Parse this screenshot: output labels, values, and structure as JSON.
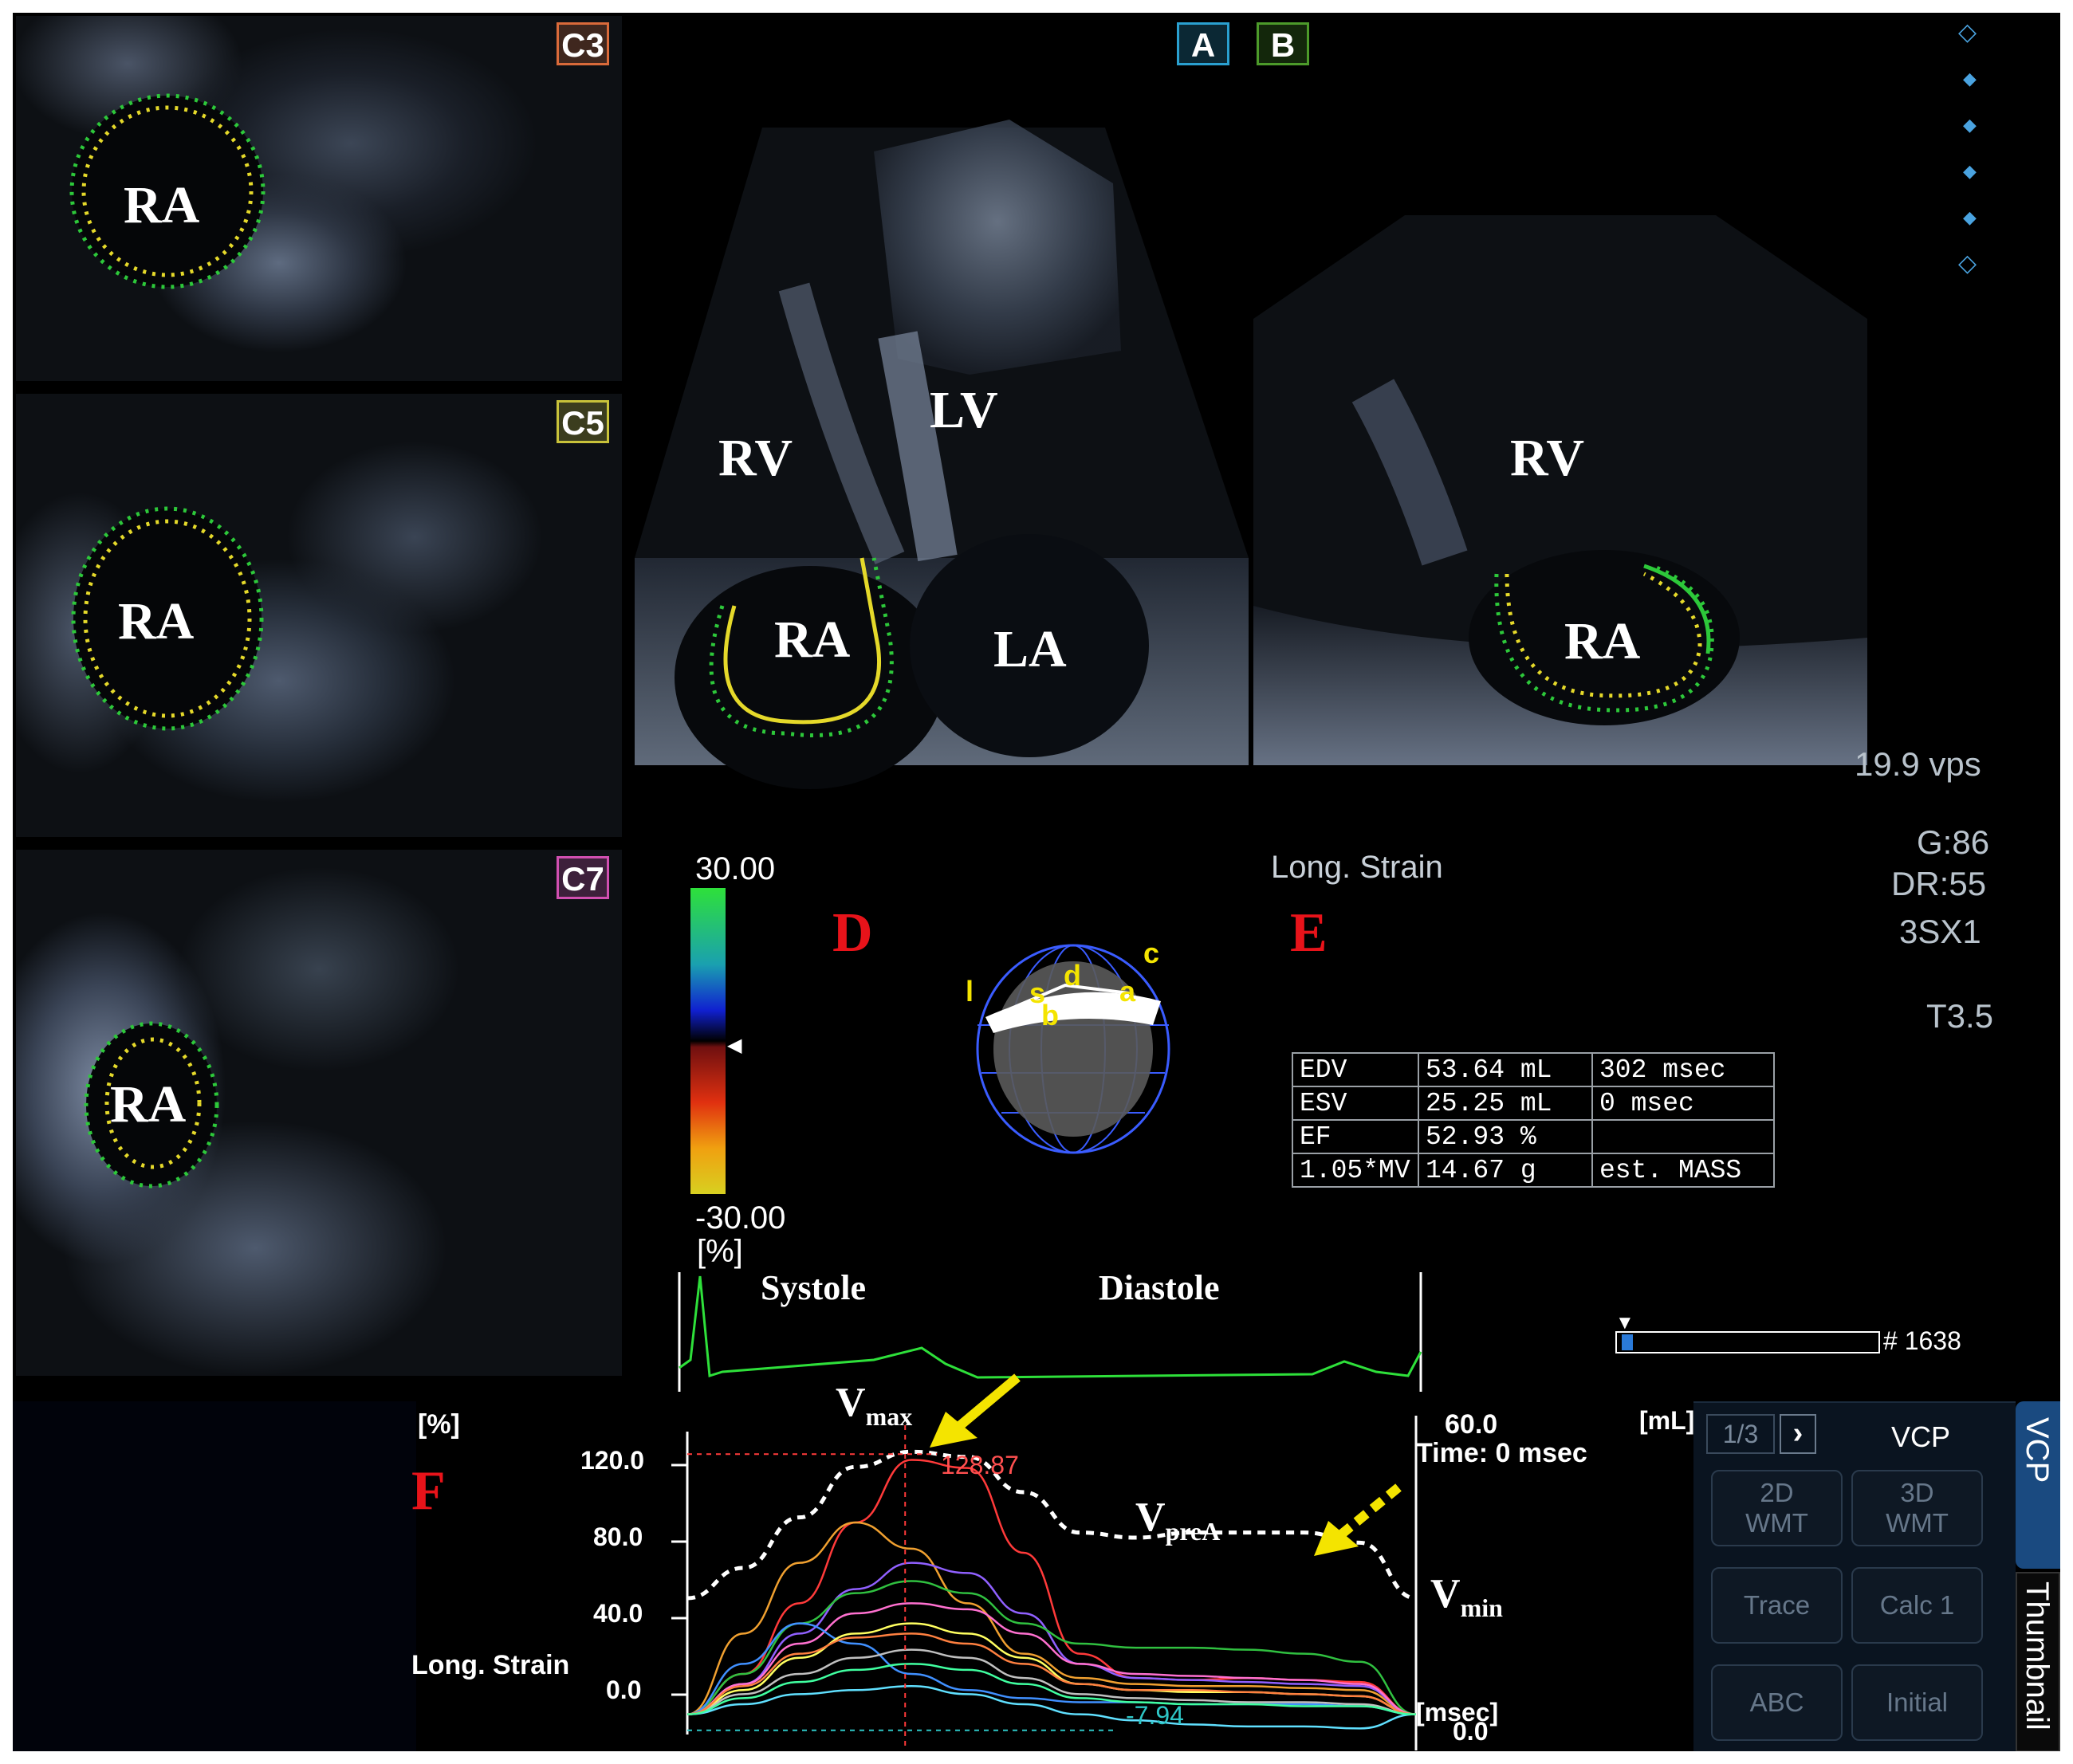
{
  "views": {
    "c3": {
      "tag": "C3",
      "label": "RA"
    },
    "c5": {
      "tag": "C5",
      "label": "RA"
    },
    "c7": {
      "tag": "C7",
      "label": "RA"
    },
    "a": {
      "tag": "A",
      "labels": {
        "rv": "RV",
        "lv": "LV",
        "ra": "RA",
        "la": "LA"
      }
    },
    "b": {
      "tag": "B",
      "labels": {
        "rv": "RV",
        "ra": "RA"
      }
    }
  },
  "tag_colors": {
    "c3": "#d96a3a",
    "c5": "#c8c23a",
    "c7": "#d04fb0",
    "a": "#2aa0d0",
    "b": "#4c9a2a"
  },
  "acq": {
    "vps": "19.9 vps",
    "gain": "G:86",
    "dr": "DR:55",
    "probe": "3SX1",
    "t": "T3.5"
  },
  "colorbar": {
    "max": "30.00",
    "min": "-30.00",
    "unit": "[%]"
  },
  "panel_letters": {
    "d": "D",
    "e": "E",
    "f": "F"
  },
  "model_labels": [
    "l",
    "s",
    "d",
    "c",
    "a",
    "b"
  ],
  "strain_title": "Long. Strain",
  "measurements": [
    [
      "EDV",
      "53.64 mL",
      "302 msec"
    ],
    [
      "ESV",
      "25.25 mL",
      "0 msec"
    ],
    [
      "EF",
      "52.93 %",
      ""
    ],
    [
      "1.05*MV",
      "14.67 g",
      "est. MASS"
    ]
  ],
  "ecg": {
    "systole": "Systole",
    "diastole": "Diastole"
  },
  "frame_slider": {
    "label": "# 1638",
    "position": 0.02
  },
  "graph": {
    "y_unit": "[%]",
    "y_ticks": [
      "120.0",
      "80.0",
      "40.0",
      "0.0"
    ],
    "y_label": "Long. Strain",
    "right_top": "60.0",
    "time": "Time: 0 msec",
    "right_unit": "[mL]",
    "x_unit": "[msec]",
    "right_bottom": "0.0",
    "peak_value": "128.87",
    "min_value": "-7.94",
    "vmax": {
      "v": "V",
      "sub": "max"
    },
    "vprea": {
      "v": "V",
      "sub": "preA"
    },
    "vmin": {
      "v": "V",
      "sub": "min"
    }
  },
  "chart_data": {
    "type": "line",
    "title": "",
    "ylabel": "Long. Strain",
    "ylim": [
      -10,
      140
    ],
    "y2lim": [
      0,
      60
    ],
    "markers": {
      "peak": 128.87,
      "min": -7.94
    },
    "series": [
      {
        "name": "",
        "color": "#ffffff",
        "style": "dashed",
        "axis": "right",
        "values": [
          27,
          33,
          43,
          53,
          56,
          55,
          48,
          40,
          39,
          40,
          40,
          40,
          38,
          27
        ]
      },
      {
        "name": "",
        "color": "#ff3a3a",
        "values": [
          0,
          20,
          55,
          95,
          126,
          122,
          80,
          30,
          18,
          17,
          18,
          17,
          16,
          0
        ]
      },
      {
        "name": "",
        "color": "#f0a030",
        "values": [
          0,
          40,
          75,
          95,
          82,
          55,
          30,
          18,
          15,
          14,
          14,
          13,
          12,
          0
        ]
      },
      {
        "name": "",
        "color": "#9060ff",
        "values": [
          0,
          15,
          40,
          62,
          75,
          70,
          50,
          25,
          18,
          17,
          16,
          15,
          14,
          0
        ]
      },
      {
        "name": "",
        "color": "#30c040",
        "values": [
          0,
          20,
          45,
          60,
          66,
          60,
          45,
          35,
          33,
          33,
          32,
          30,
          26,
          0
        ]
      },
      {
        "name": "",
        "color": "#ff70d0",
        "values": [
          0,
          15,
          35,
          50,
          55,
          52,
          40,
          25,
          20,
          19,
          18,
          17,
          15,
          0
        ]
      },
      {
        "name": "",
        "color": "#4090ff",
        "values": [
          0,
          25,
          45,
          35,
          20,
          12,
          8,
          6,
          6,
          5,
          5,
          5,
          4,
          0
        ]
      },
      {
        "name": "",
        "color": "#ffff60",
        "values": [
          0,
          12,
          28,
          40,
          45,
          40,
          28,
          15,
          12,
          11,
          11,
          10,
          9,
          0
        ]
      },
      {
        "name": "",
        "color": "#60e0ff",
        "values": [
          0,
          5,
          10,
          12,
          14,
          10,
          5,
          0,
          -3,
          -5,
          -6,
          -6,
          -7,
          0
        ]
      },
      {
        "name": "",
        "color": "#c0c0c0",
        "values": [
          0,
          10,
          20,
          28,
          32,
          28,
          18,
          10,
          8,
          7,
          6,
          6,
          5,
          0
        ]
      },
      {
        "name": "",
        "color": "#ff8040",
        "values": [
          0,
          14,
          30,
          38,
          40,
          35,
          25,
          15,
          12,
          12,
          11,
          10,
          9,
          0
        ]
      },
      {
        "name": "",
        "color": "#40ffa0",
        "values": [
          0,
          8,
          16,
          22,
          25,
          22,
          15,
          8,
          6,
          5,
          5,
          4,
          4,
          0
        ]
      }
    ]
  },
  "vcp": {
    "page": "1/3",
    "next": "›",
    "title": "VCP",
    "buttons": [
      "2D\nWMT",
      "3D\nWMT",
      "Trace",
      "Calc 1",
      "ABC",
      "Initial"
    ],
    "side_tabs": [
      "VCP",
      "Thumbnail"
    ]
  }
}
